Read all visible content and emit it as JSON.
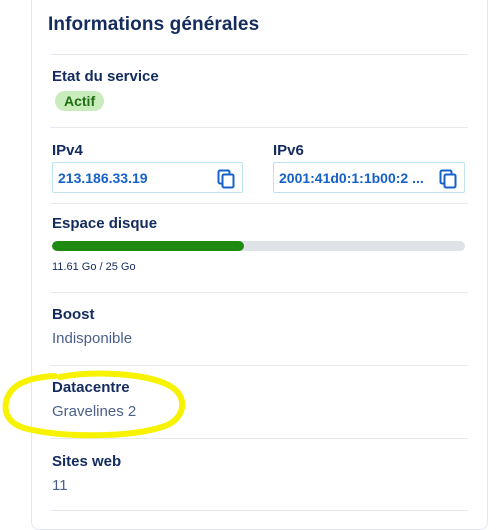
{
  "card": {
    "title": "Informations générales"
  },
  "service_state": {
    "label": "Etat du service",
    "status": "Actif",
    "status_color": "#c9ecbc"
  },
  "ipv4": {
    "label": "IPv4",
    "value": "213.186.33.19",
    "copy_icon": "copy-icon"
  },
  "ipv6": {
    "label": "IPv6",
    "value": "2001:41d0:1:1b00:2 ...",
    "copy_icon": "copy-icon"
  },
  "disk": {
    "label": "Espace disque",
    "caption": "11.61 Go / 25 Go",
    "used_fraction": 0.4644,
    "bar_color": "#1e8a12"
  },
  "boost": {
    "label": "Boost",
    "value": "Indisponible"
  },
  "datacenter": {
    "label": "Datacentre",
    "value": "Gravelines 2",
    "highlight_color": "#f7f200"
  },
  "websites": {
    "label": "Sites web",
    "value": "11"
  }
}
